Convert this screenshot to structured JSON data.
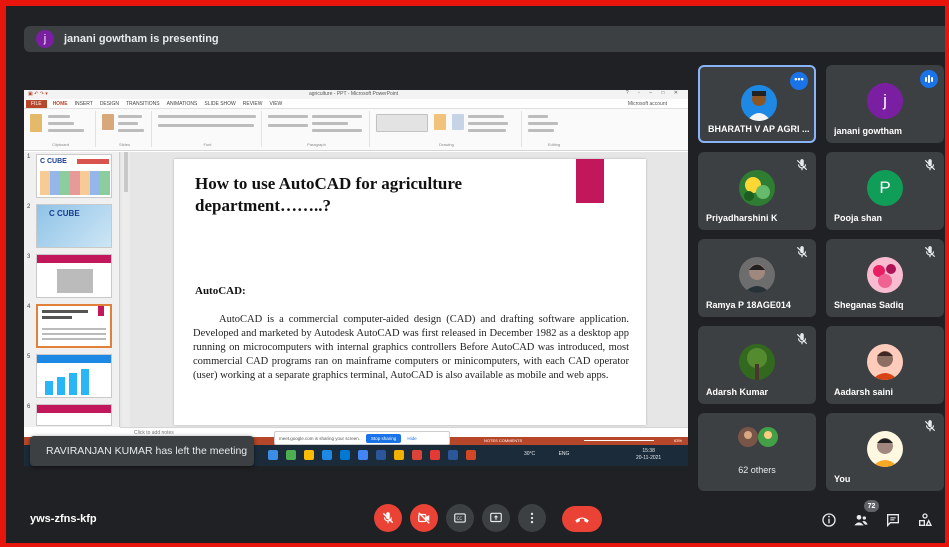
{
  "presenting": {
    "avatar_letter": "j",
    "text": "janani gowtham is presenting"
  },
  "ppt": {
    "window_title": "agriculture - PPT - Microsoft PowerPoint",
    "tabs": [
      "FILE",
      "HOME",
      "INSERT",
      "DESIGN",
      "TRANSITIONS",
      "ANIMATIONS",
      "SLIDE SHOW",
      "REVIEW",
      "VIEW"
    ],
    "account": "Microsoft account",
    "ribbon_groups": [
      "Clipboard",
      "Slides",
      "Font",
      "Paragraph",
      "Drawing",
      "Editing"
    ],
    "thumbnail_numbers": [
      "1",
      "2",
      "3",
      "4",
      "5",
      "6"
    ],
    "thumb1_logo": "C CUBE",
    "thumb2_logo": "C CUBE",
    "notes_placeholder": "Click to add notes",
    "status_right": "NOTES   COMMENTS",
    "zoom": "63%",
    "accent_color": "#b7472a"
  },
  "slide": {
    "title": "How to use AutoCAD for agriculture department……..?",
    "heading": "AutoCAD:",
    "body": "AutoCAD is a commercial computer-aided design (CAD) and drafting software application. Developed and marketed by Autodesk AutoCAD was first released in December 1982 as a desktop app running on microcomputers with internal graphics controllers Before AutoCAD was introduced, most commercial CAD programs ran on mainframe computers or minicomputers, with each CAD operator (user) working at a separate graphics terminal, AutoCAD is also available as mobile and web apps."
  },
  "share_banner": {
    "text": "meet.google.com is sharing your screen.",
    "stop_label": "Stop sharing",
    "hide_label": "Hide"
  },
  "taskbar": {
    "weather": "30°C",
    "lang": "ENG",
    "time": "15:38",
    "date": "20-11-2021"
  },
  "toast": {
    "text": "RAVIRANJAN KUMAR has left the meeting"
  },
  "participants": {
    "bharath": {
      "name": "BHARATH V AP AGRI ...",
      "menu": "•••"
    },
    "janani": {
      "name": "janani gowtham",
      "letter": "j",
      "color": "#7b1fa2"
    },
    "priyadharshini": {
      "name": "Priyadharshini K"
    },
    "pooja": {
      "name": "Pooja shan",
      "letter": "P",
      "color": "#0f9d58"
    },
    "ramya": {
      "name": "Ramya P 18AGE014"
    },
    "sheganas": {
      "name": "Sheganas Sadiq"
    },
    "adarsh": {
      "name": "Adarsh Kumar"
    },
    "aadarsh": {
      "name": "Aadarsh saini"
    },
    "others": {
      "name": "62 others"
    },
    "you": {
      "name": "You"
    }
  },
  "bottom": {
    "meeting_code": "yws-zfns-kfp",
    "people_count": "72"
  },
  "icons": [
    "mic-off-icon",
    "camera-off-icon",
    "captions-icon",
    "present-icon",
    "more-options-icon",
    "end-call-icon",
    "info-icon",
    "people-icon",
    "chat-icon",
    "activities-icon"
  ]
}
